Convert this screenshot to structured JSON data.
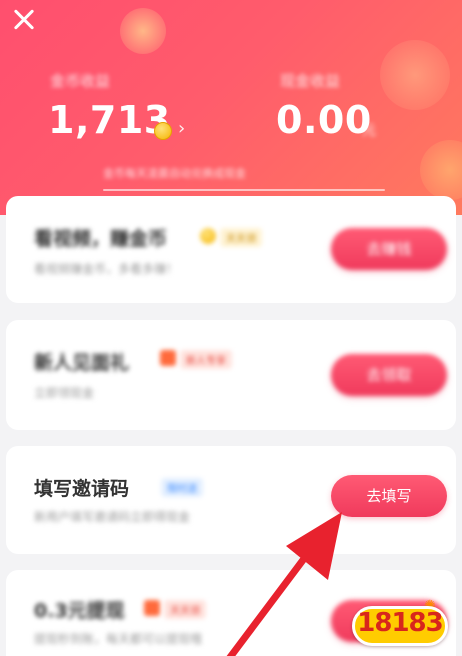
{
  "header": {
    "coin_label": "金币收益",
    "coin_value": "1,713",
    "cash_label": "现金收益",
    "cash_value": "0.00",
    "cash_unit": "元",
    "chevron": "›",
    "notice": "金币每天凌晨自动兑换成现金"
  },
  "tasks": [
    {
      "title": "看视频，赚金币",
      "badge": "天天领",
      "subtitle": "看视频赚金币，多看多赚！",
      "button": "去赚钱"
    },
    {
      "title": "新人见面礼",
      "badge": "新人专享",
      "subtitle": "立即领现金",
      "button": "去领取"
    },
    {
      "title": "填写邀请码",
      "badge": "限时送",
      "subtitle": "新用户填写邀请码立即得现金",
      "button": "去填写"
    },
    {
      "title": "0.3元提现",
      "badge": "天天领",
      "subtitle": "提现秒到账，每天都可以提现哦",
      "button": "去提现"
    }
  ],
  "watermark": {
    "text": "18183"
  },
  "colors": {
    "accent": "#f03a5c",
    "arrow": "#e8222e",
    "header_start": "#ff4f6e",
    "header_end": "#ff7a5e"
  },
  "icons": {
    "close": "close-icon",
    "coin": "coin-icon",
    "arrow": "pointer-arrow-icon"
  }
}
